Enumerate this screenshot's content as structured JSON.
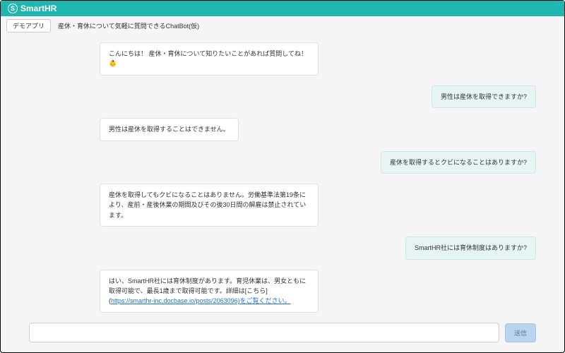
{
  "header": {
    "brand": "SmartHR",
    "tab_label": "デモアプリ",
    "page_title": "産休・育休について気軽に質問できるChatBot(仮)"
  },
  "messages": [
    {
      "role": "bot",
      "text": "こんにちは！ 産休・育休について知りたいことがあれば質問してね！👶"
    },
    {
      "role": "user",
      "text": "男性は産休を取得できますか?"
    },
    {
      "role": "bot",
      "text": "男性は産休を取得することはできません。"
    },
    {
      "role": "user",
      "text": "産休を取得するとクビになることはありますか?"
    },
    {
      "role": "bot",
      "text": "産休を取得してもクビになることはありません。労働基準法第19条により、産前・産後休業の期間及びその後30日間の解雇は禁止されています。"
    },
    {
      "role": "user",
      "text": "SmartHR社には育休制度はありますか?"
    },
    {
      "role": "bot",
      "text_pre": "はい、SmartHR社には育休制度があります。育児休業は、男女ともに取得可能で、最長1歳まで取得可能です。詳細は[こちら](",
      "link_text": "https://smarthr-inc.docbase.io/posts/2063096)をご覧ください。",
      "text_post": ""
    }
  ],
  "input": {
    "placeholder": "",
    "send_label": "送信"
  }
}
